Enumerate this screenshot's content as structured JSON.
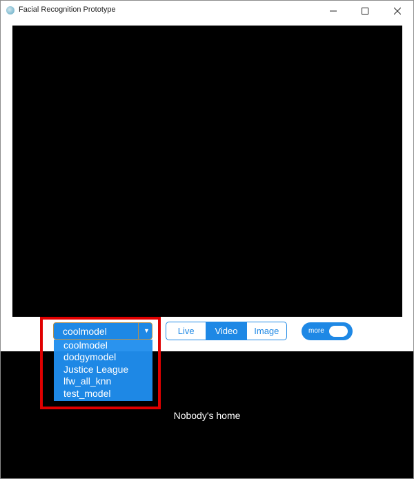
{
  "window": {
    "title": "Facial Recognition Prototype",
    "controls": {
      "minimize": "–",
      "maximize": "☐",
      "close": "✕"
    }
  },
  "model_select": {
    "selected": "coolmodel",
    "arrow": "▼",
    "options": [
      "coolmodel",
      "dodgymodel",
      "Justice League",
      "lfw_all_knn",
      "test_model"
    ]
  },
  "source_tabs": {
    "live": "Live",
    "video": "Video",
    "image": "Image",
    "active": "Video"
  },
  "more_toggle": {
    "label": "more"
  },
  "status": "Nobody's home",
  "colors": {
    "accent": "#1e88e5",
    "highlight_border": "#e00000",
    "video_bg": "#000000"
  }
}
